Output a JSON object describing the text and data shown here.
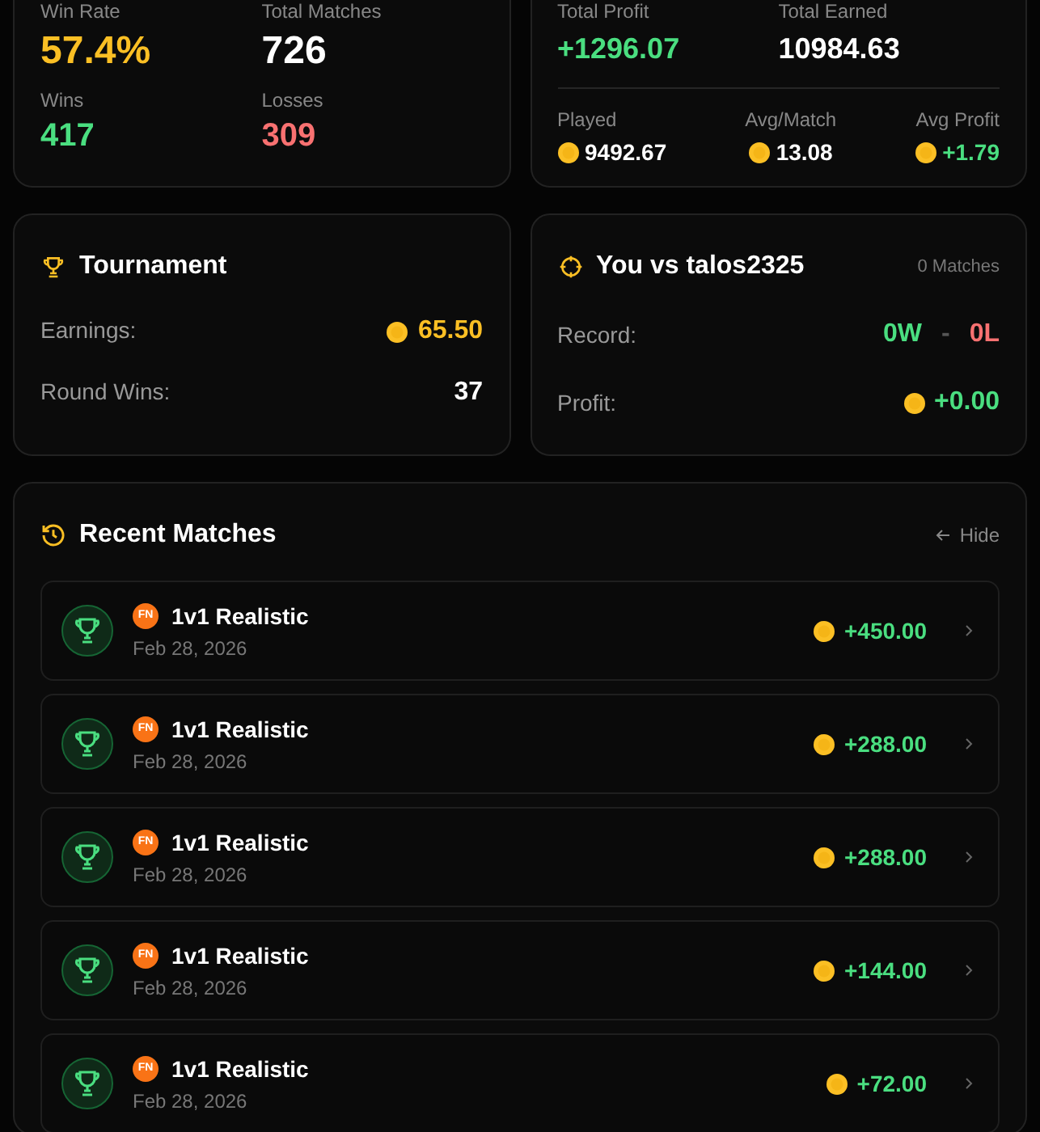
{
  "overview": {
    "stats": [
      {
        "label": "Win Rate",
        "value": "57.4%",
        "color": "#fbbf24"
      },
      {
        "label": "Total Matches",
        "value": "726",
        "color": "#ffffff"
      },
      {
        "label": "Wins",
        "value": "417",
        "color": "#4ade80"
      },
      {
        "label": "Losses",
        "value": "309",
        "color": "#f87171"
      }
    ]
  },
  "earnings": {
    "top": [
      {
        "label": "Total Profit",
        "value": "+1296.07",
        "color": "#4ade80"
      },
      {
        "label": "Total Earned",
        "value": "10984.63",
        "color": "#ffffff"
      }
    ],
    "bottom": [
      {
        "label": "Played",
        "value": "9492.67",
        "color": "#ffffff"
      },
      {
        "label": "Avg/Match",
        "value": "13.08",
        "color": "#ffffff"
      },
      {
        "label": "Avg Profit",
        "value": "+1.79",
        "color": "#4ade80"
      }
    ]
  },
  "tournament": {
    "title": "Tournament",
    "rows": [
      {
        "label": "Earnings:",
        "value": "65.50",
        "color": "#fbbf24",
        "coin": true
      },
      {
        "label": "Round Wins:",
        "value": "37",
        "color": "#ffffff",
        "coin": false
      }
    ]
  },
  "versus": {
    "title": "You vs talos2325",
    "count": "0 Matches",
    "record_label": "Record:",
    "wins": "0W",
    "separator": "-",
    "losses": "0L",
    "profit_label": "Profit:",
    "profit": "+0.00"
  },
  "recent": {
    "title": "Recent Matches",
    "hide": "Hide",
    "matches": [
      {
        "badge": "FN",
        "mode": "1v1 Realistic",
        "date": "Feb 28, 2026",
        "amount": "+450.00"
      },
      {
        "badge": "FN",
        "mode": "1v1 Realistic",
        "date": "Feb 28, 2026",
        "amount": "+288.00"
      },
      {
        "badge": "FN",
        "mode": "1v1 Realistic",
        "date": "Feb 28, 2026",
        "amount": "+288.00"
      },
      {
        "badge": "FN",
        "mode": "1v1 Realistic",
        "date": "Feb 28, 2026",
        "amount": "+144.00"
      },
      {
        "badge": "FN",
        "mode": "1v1 Realistic",
        "date": "Feb 28, 2026",
        "amount": "+72.00"
      }
    ]
  }
}
